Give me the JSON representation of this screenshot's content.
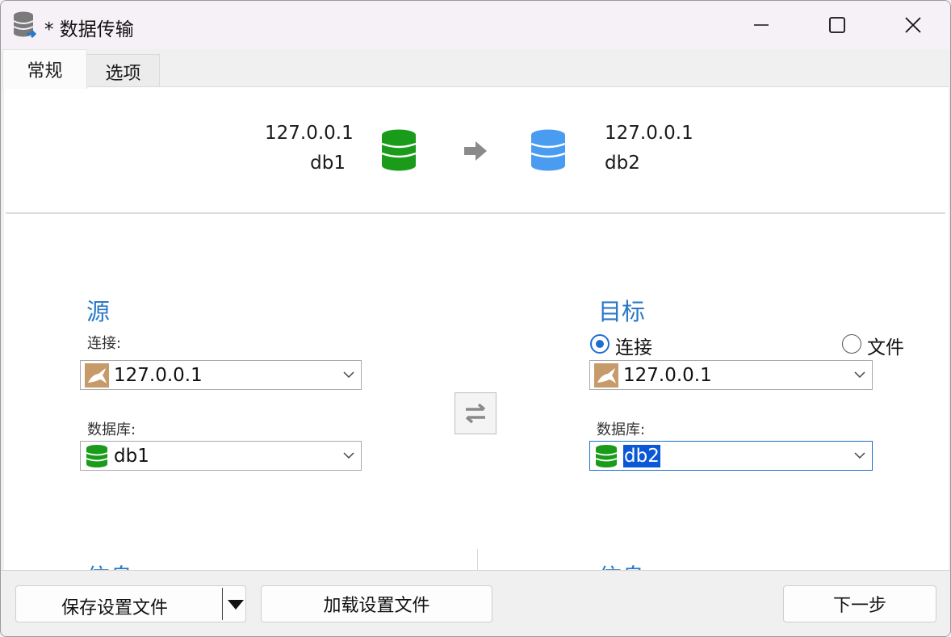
{
  "window": {
    "title": "* 数据传输"
  },
  "tabs": [
    {
      "label": "常规",
      "active": true
    },
    {
      "label": "选项",
      "active": false
    }
  ],
  "summary": {
    "source_host": "127.0.0.1",
    "source_db": "db1",
    "target_host": "127.0.0.1",
    "target_db": "db2",
    "source_icon": "green-database-icon",
    "target_icon": "blue-database-icon",
    "arrow_icon": "arrow-right-icon"
  },
  "source": {
    "title": "源",
    "connection_label": "连接:",
    "connection_value": "127.0.0.1",
    "database_label": "数据库:",
    "database_value": "db1"
  },
  "target": {
    "title": "目标",
    "radio_connection": "连接",
    "radio_file": "文件",
    "selected_mode": "连接",
    "connection_value": "127.0.0.1",
    "database_label": "数据库:",
    "database_value": "db2"
  },
  "partial_sections": {
    "left_title": "信息",
    "right_title": "信息"
  },
  "buttons": {
    "save_settings": "保存设置文件",
    "load_settings": "加载设置文件",
    "next": "下一步"
  },
  "colors": {
    "accent": "#2b78c8",
    "db_green": "#1a9b1a",
    "db_blue": "#4a9cf0",
    "mysql_tan": "#c79a6a"
  }
}
